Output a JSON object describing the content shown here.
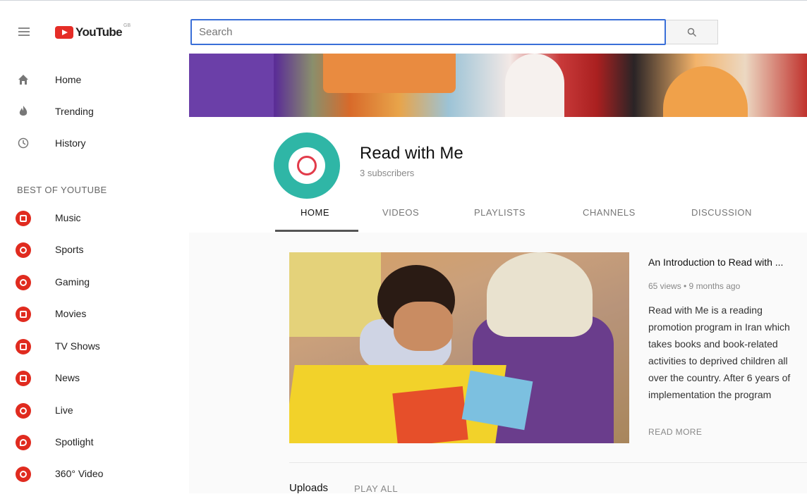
{
  "topbar": {
    "logo_text": "YouTube",
    "logo_region": "GB",
    "search_placeholder": "Search"
  },
  "sidebar": {
    "main": [
      {
        "label": "Home",
        "icon": "home-icon"
      },
      {
        "label": "Trending",
        "icon": "flame-icon"
      },
      {
        "label": "History",
        "icon": "history-icon"
      }
    ],
    "section_title": "BEST OF YOUTUBE",
    "categories": [
      {
        "label": "Music",
        "icon": "music-icon"
      },
      {
        "label": "Sports",
        "icon": "sports-icon"
      },
      {
        "label": "Gaming",
        "icon": "gaming-icon"
      },
      {
        "label": "Movies",
        "icon": "movies-icon"
      },
      {
        "label": "TV Shows",
        "icon": "tv-icon"
      },
      {
        "label": "News",
        "icon": "news-icon"
      },
      {
        "label": "Live",
        "icon": "live-icon"
      },
      {
        "label": "Spotlight",
        "icon": "spotlight-icon"
      },
      {
        "label": "360° Video",
        "icon": "360-video-icon"
      }
    ]
  },
  "channel": {
    "title": "Read with Me",
    "subscribers": "3 subscribers",
    "tabs": [
      "HOME",
      "VIDEOS",
      "PLAYLISTS",
      "CHANNELS",
      "DISCUSSION"
    ],
    "active_tab": "HOME"
  },
  "featured": {
    "title": "An Introduction to Read with ...",
    "meta": "65 views • 9 months ago",
    "description": "Read with Me is a reading promotion program in Iran which takes books and book-related activities to deprived children all over the country. After 6 years of implementation the program",
    "read_more": "READ MORE"
  },
  "uploads": {
    "title": "Uploads",
    "play_all": "PLAY ALL"
  },
  "colors": {
    "accent_red": "#e02b1f",
    "search_border": "#3a6fd8",
    "avatar_teal": "#2fb6a6"
  }
}
